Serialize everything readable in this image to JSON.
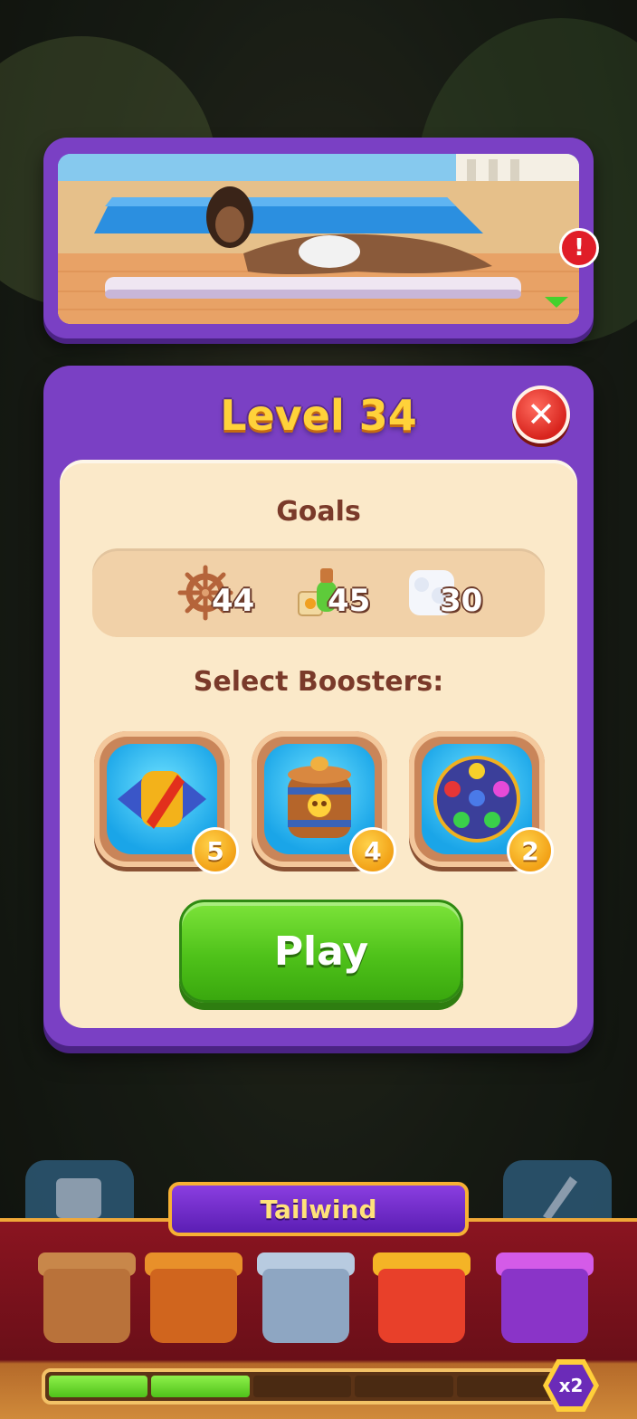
{
  "dialog": {
    "title": "Level 34",
    "goals_label": "Goals",
    "goals": [
      {
        "icon": "ship-wheel-icon",
        "count": "44"
      },
      {
        "icon": "potion-bottle-icon",
        "count": "45"
      },
      {
        "icon": "foam-tile-icon",
        "count": "30"
      }
    ],
    "boosters_label": "Select Boosters:",
    "boosters": [
      {
        "icon": "rocket-booster-icon",
        "count": "5"
      },
      {
        "icon": "bomb-barrel-icon",
        "count": "4"
      },
      {
        "icon": "color-ball-icon",
        "count": "2"
      }
    ],
    "play_label": "Play"
  },
  "alert_badge": "!",
  "bottom": {
    "tailwind_label": "Tailwind",
    "multiplier": "x2",
    "progress": 0.4,
    "progress_segments": 5
  },
  "colors": {
    "panel_purple": "#7a40c4",
    "inner_cream": "#fbe9c9",
    "title_gold": "#ffd23a",
    "play_green": "#4fc21a",
    "close_red": "#d8241d"
  }
}
